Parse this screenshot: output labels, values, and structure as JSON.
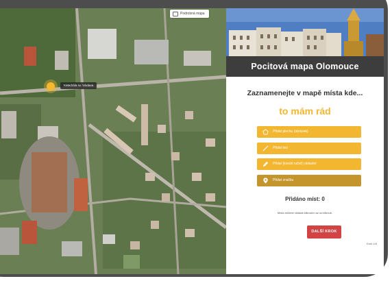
{
  "map": {
    "layer_toggle_label": "Podrobná mapa",
    "layer_toggle_icon": "layers-icon",
    "marker_label": "Katedrála sv. Václava"
  },
  "panel": {
    "title": "Pocitová mapa Olomouce",
    "heading": "Zaznamenejte v mapě místa kde...",
    "subheading": "to mám rád",
    "actions": [
      {
        "label": "Přidat plochu (obrázek)",
        "icon": "pentagon-icon"
      },
      {
        "label": "Přidat linii",
        "icon": "line-icon"
      },
      {
        "label": "Přidat (kreslit ručně) oblastní",
        "icon": "pencil-icon"
      },
      {
        "label": "Přidat značku",
        "icon": "map-marker-icon"
      }
    ],
    "added_count_label": "Přidáno míst: 0",
    "hint": "Místa můžete vkládat kliknutím až od kliknutí.",
    "next_button_label": "DALŠÍ KROK",
    "step_label": "Krok 1/8"
  },
  "colors": {
    "accent_yellow": "#f2b630",
    "active_action": "#c4952d",
    "next_button": "#d24343",
    "title_bar": "#3d3d3d"
  }
}
